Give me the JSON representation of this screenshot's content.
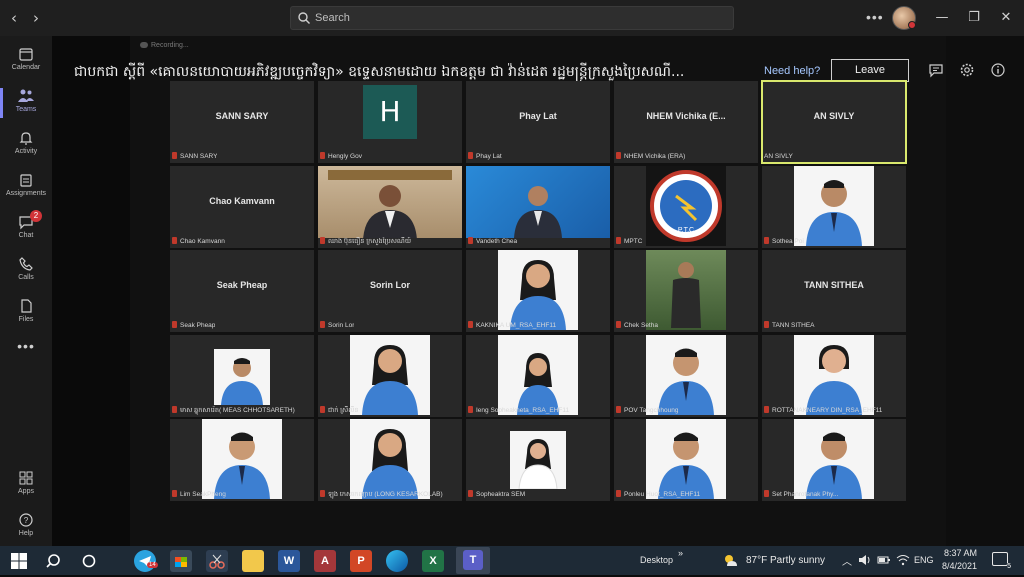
{
  "search": {
    "placeholder": "Search"
  },
  "sidebar": {
    "items": [
      {
        "label": "Calendar"
      },
      {
        "label": "Teams"
      },
      {
        "label": "Activity"
      },
      {
        "label": "Assignments"
      },
      {
        "label": "Chat",
        "badge": "2"
      },
      {
        "label": "Calls"
      },
      {
        "label": "Files"
      },
      {
        "label": "Apps"
      },
      {
        "label": "Help"
      }
    ]
  },
  "meeting": {
    "recording": "Recording...",
    "title": "ជាបកជា ស្តីពី «គោលនយោបាយអភិវឌ្ឍបច្ចេកវិទ្យា» ឧទ្ទេសនាមដោយ ឯកឧត្តម ជា វ៉ាន់ដេត រដ្ឋមន្ត្រីក្រសួងប្រៃសណី...",
    "need_help": "Need help?",
    "leave": "Leave"
  },
  "tiles": [
    {
      "initials": "SANN SARY",
      "caption": "SANN SARY"
    },
    {
      "letter": "H",
      "caption": "Hengly Gov"
    },
    {
      "initials": "Phay Lat",
      "caption": "Phay Lat"
    },
    {
      "initials": "NHEM Vichika (E...",
      "caption": "NHEM Vichika (ERA)"
    },
    {
      "initials": "AN SIVLY",
      "caption": "AN SIVLY"
    },
    {
      "initials": "Chao Kamvann",
      "caption": "Chao Kamvann"
    },
    {
      "caption": "ឈាង ប៊ុនធឿន ក្រសួងប្រៃសណីយ៍"
    },
    {
      "caption": "Vandeth Chea"
    },
    {
      "logo_text": "P.T.C",
      "caption": "MPTC"
    },
    {
      "caption": "Sothea Poi"
    },
    {
      "initials": "Seak Pheap",
      "caption": "Seak Pheap"
    },
    {
      "initials": "Sorin Lor",
      "caption": "Sorin Lor"
    },
    {
      "caption": "KAKNIKA UM_RSA_EHF11"
    },
    {
      "caption": "Chek Setha"
    },
    {
      "initials": "TANN SITHEA",
      "caption": "TANN SITHEA"
    },
    {
      "caption": "មាស ឆ្នុកសារ៉េត( MEAS CHHOTSARETH)"
    },
    {
      "caption": "ជាក់ ស្រីលីន"
    },
    {
      "caption": "Ieng Sopheakneta_RSA_EHF11"
    },
    {
      "caption": "POV Tangchhoung"
    },
    {
      "caption": "ROTTANAKNEARY DIN_RSA_EHF11"
    },
    {
      "caption": "Lim SeakPheng"
    },
    {
      "caption": "ឡុង កេសរកល្យាប (LONG KESARKOLAB)"
    },
    {
      "caption": "Sopheaktra SEM"
    },
    {
      "caption": "Ponleu Huot_RSA_EHF11"
    },
    {
      "caption": "Set Phanrotanak Phy..."
    }
  ],
  "taskbar": {
    "desktop": "Desktop",
    "weather": "87°F  Partly sunny",
    "lang": "ENG",
    "time": "8:37 AM",
    "date": "8/4/2021",
    "telegram_badge": "14",
    "notif_count": "5"
  },
  "colors": {
    "accent": "#7f85f5",
    "active_speaker": "#d9e86d",
    "uniform": "#3d7fd1",
    "taskbar": "#1e2a36"
  }
}
